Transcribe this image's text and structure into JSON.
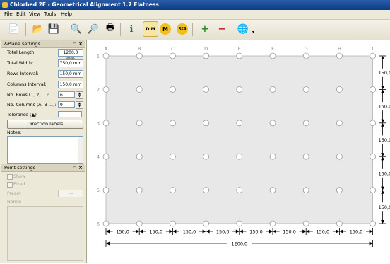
{
  "window": {
    "title": "Chlorbed 2F - Geometrical Alignment 1.7 Flatness"
  },
  "menu": [
    "File",
    "Edit",
    "View",
    "Tools",
    "Help"
  ],
  "toolbar": {
    "buttons": [
      {
        "name": "new-icon",
        "glyph": "📄"
      },
      {
        "name": "open-folder-icon",
        "glyph": "📂"
      },
      {
        "name": "save-icon",
        "glyph": "💾"
      },
      {
        "name": "print-preview-icon",
        "glyph": "🔍"
      },
      {
        "name": "preview-icon",
        "glyph": "🔎"
      },
      {
        "name": "print-icon",
        "glyph": "🖶"
      },
      {
        "name": "info-icon",
        "glyph": "ℹ"
      },
      {
        "name": "dim-icon",
        "glyph": "DIM"
      },
      {
        "name": "m-icon",
        "glyph": "M"
      },
      {
        "name": "res-icon",
        "glyph": "RES"
      },
      {
        "name": "zoom-in-icon",
        "glyph": "+"
      },
      {
        "name": "zoom-out-icon",
        "glyph": "−"
      },
      {
        "name": "globe-icon",
        "glyph": "🌐"
      }
    ]
  },
  "plane_settings": {
    "header": "&Plane settings",
    "pin": "ᵖ",
    "close": "×",
    "total_length_label": "Total Length:",
    "total_length_value": "1200,0 mm",
    "total_width_label": "Total Width:",
    "total_width_value": "750,0 mm",
    "rows_interval_label": "Rows Interval:",
    "rows_interval_value": "150,0 mm",
    "columns_interval_label": "Columns Interval:",
    "columns_interval_value": "150,0 mm",
    "rows_label": "No. Rows (1, 2, ...):",
    "rows_value": "6",
    "columns_label": "No. Columns (A, B ...):",
    "columns_value": "9",
    "tolerance_label": "Tolerance (▲)",
    "tolerance_value": "---",
    "direction_button": "Direction labels",
    "notes_label": "Notes:"
  },
  "point_settings": {
    "header": "Point settings",
    "pin": "ᵖ",
    "close": "×",
    "show_label": "Show",
    "fixed_label": "Fixed",
    "preset_label": "Preset",
    "preset_value": "---",
    "name_label": "Name:"
  },
  "grid": {
    "columns": [
      "A",
      "B",
      "C",
      "D",
      "E",
      "F",
      "G",
      "H",
      "I"
    ],
    "rows": [
      "1",
      "2",
      "3",
      "4",
      "5",
      "6"
    ],
    "col_interval": "150,0",
    "row_interval": "150,0",
    "total_length": "1200,0",
    "colors": {
      "plane": "#e8e8e8",
      "point_fill": "#ffffff",
      "point_stroke": "#9a9a9a",
      "dim_line": "#000000"
    }
  }
}
